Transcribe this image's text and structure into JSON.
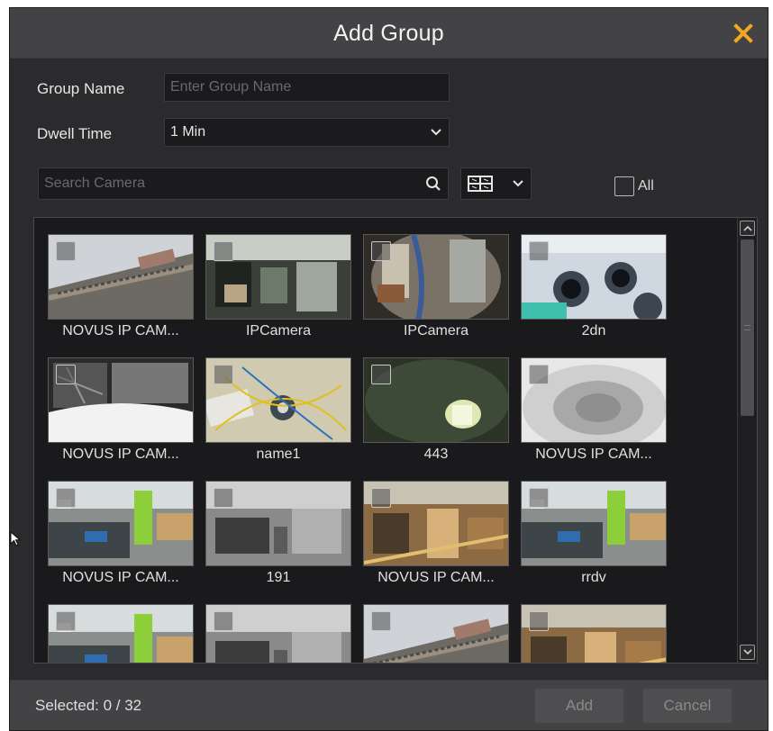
{
  "dialog": {
    "title": "Add Group",
    "close_icon": "close-icon",
    "accent_color": "#f5a623"
  },
  "form": {
    "group_name_label": "Group Name",
    "group_name_placeholder": "Enter Group Name",
    "group_name_value": "",
    "dwell_time_label": "Dwell Time",
    "dwell_time_value": "1 Min",
    "search_placeholder": "Search Camera",
    "view_mode_icon": "grid-view-icon",
    "all_label": "All"
  },
  "cameras": [
    {
      "name": "NOVUS IP CAM...",
      "scene": "street"
    },
    {
      "name": "IPCamera",
      "scene": "office"
    },
    {
      "name": "IPCamera",
      "scene": "fisheye-office"
    },
    {
      "name": "2dn",
      "scene": "cameras"
    },
    {
      "name": "NOVUS IP CAM...",
      "scene": "ir-fisheye"
    },
    {
      "name": "name1",
      "scene": "wires"
    },
    {
      "name": "443",
      "scene": "light"
    },
    {
      "name": "NOVUS IP CAM...",
      "scene": "fog"
    },
    {
      "name": "NOVUS IP CAM...",
      "scene": "office-color"
    },
    {
      "name": "191",
      "scene": "office-gray"
    },
    {
      "name": "NOVUS IP CAM...",
      "scene": "office-warm"
    },
    {
      "name": "rrdv",
      "scene": "office-color"
    },
    {
      "name": "",
      "scene": "office-color"
    },
    {
      "name": "",
      "scene": "office-gray"
    },
    {
      "name": "",
      "scene": "street"
    },
    {
      "name": "",
      "scene": "office-warm"
    }
  ],
  "footer": {
    "selected_label": "Selected: 0 / 32",
    "add_label": "Add",
    "cancel_label": "Cancel"
  }
}
